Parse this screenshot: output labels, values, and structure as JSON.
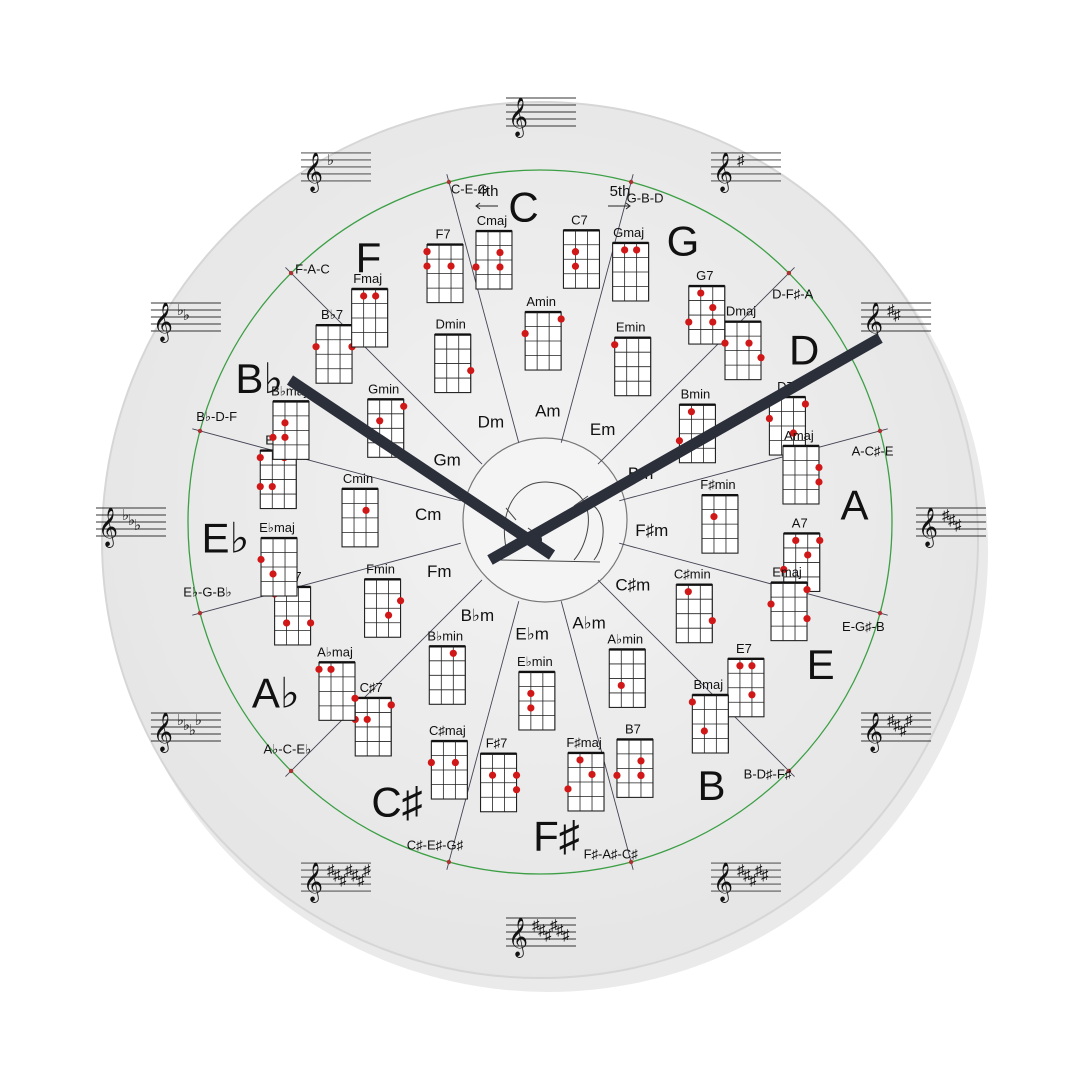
{
  "clock": {
    "theme": {
      "face": "#ececec",
      "ring": "#2e9e3e",
      "hand": "#2b2f3a",
      "dot": "#d01818"
    },
    "keys": [
      {
        "key": "C",
        "triad": "C-E-G",
        "major": "Cmaj",
        "dom7": "C7",
        "minor": "Amin",
        "relative": "Am",
        "signature": "no accidentals"
      },
      {
        "key": "G",
        "triad": "G-B-D",
        "major": "Gmaj",
        "dom7": "G7",
        "minor": "Emin",
        "relative": "Em",
        "signature": "1 sharp"
      },
      {
        "key": "D",
        "triad": "D-F♯-A",
        "major": "Dmaj",
        "dom7": "D7",
        "minor": "Bmin",
        "relative": "Bm",
        "signature": "2 sharps"
      },
      {
        "key": "A",
        "triad": "A-C♯-E",
        "major": "Amaj",
        "dom7": "A7",
        "minor": "F♯min",
        "relative": "F♯m",
        "signature": "3 sharps"
      },
      {
        "key": "E",
        "triad": "E-G♯-B",
        "major": "Emaj",
        "dom7": "E7",
        "minor": "C♯min",
        "relative": "C♯m",
        "signature": "4 sharps"
      },
      {
        "key": "B",
        "triad": "B-D♯-F♯",
        "major": "Bmaj",
        "dom7": "B7",
        "minor": "A♭min",
        "relative": "A♭m",
        "signature": "5 sharps"
      },
      {
        "key": "F♯",
        "triad": "F♯-A♯-C♯",
        "major": "F♯maj",
        "dom7": "F♯7",
        "minor": "E♭min",
        "relative": "E♭m",
        "signature": "6 sharps / 6 flats"
      },
      {
        "key": "C♯",
        "triad": "C♯-E♯-G♯",
        "major": "C♯maj",
        "dom7": "C♯7",
        "minor": "B♭min",
        "relative": "B♭m",
        "signature": "5 flats / 7 sharps"
      },
      {
        "key": "A♭",
        "triad": "A♭-C-E♭",
        "major": "A♭maj",
        "dom7": "A♭7",
        "minor": "Fmin",
        "relative": "Fm",
        "signature": "4 flats"
      },
      {
        "key": "E♭",
        "triad": "E♭-G-B♭",
        "major": "E♭maj",
        "dom7": "E♭7",
        "minor": "Cmin",
        "relative": "Cm",
        "signature": "3 flats"
      },
      {
        "key": "B♭",
        "triad": "B♭-D-F",
        "major": "B♭maj",
        "dom7": "B♭7",
        "minor": "Gmin",
        "relative": "Gm",
        "signature": "2 flats"
      },
      {
        "key": "F",
        "triad": "F-A-C",
        "major": "Fmaj",
        "dom7": "F7",
        "minor": "Dmin",
        "relative": "Dm",
        "signature": "1 flat"
      }
    ],
    "arrows": {
      "fourth": "4th",
      "fifth": "5th"
    },
    "hands": {
      "hour": "10",
      "minute": "10"
    }
  }
}
